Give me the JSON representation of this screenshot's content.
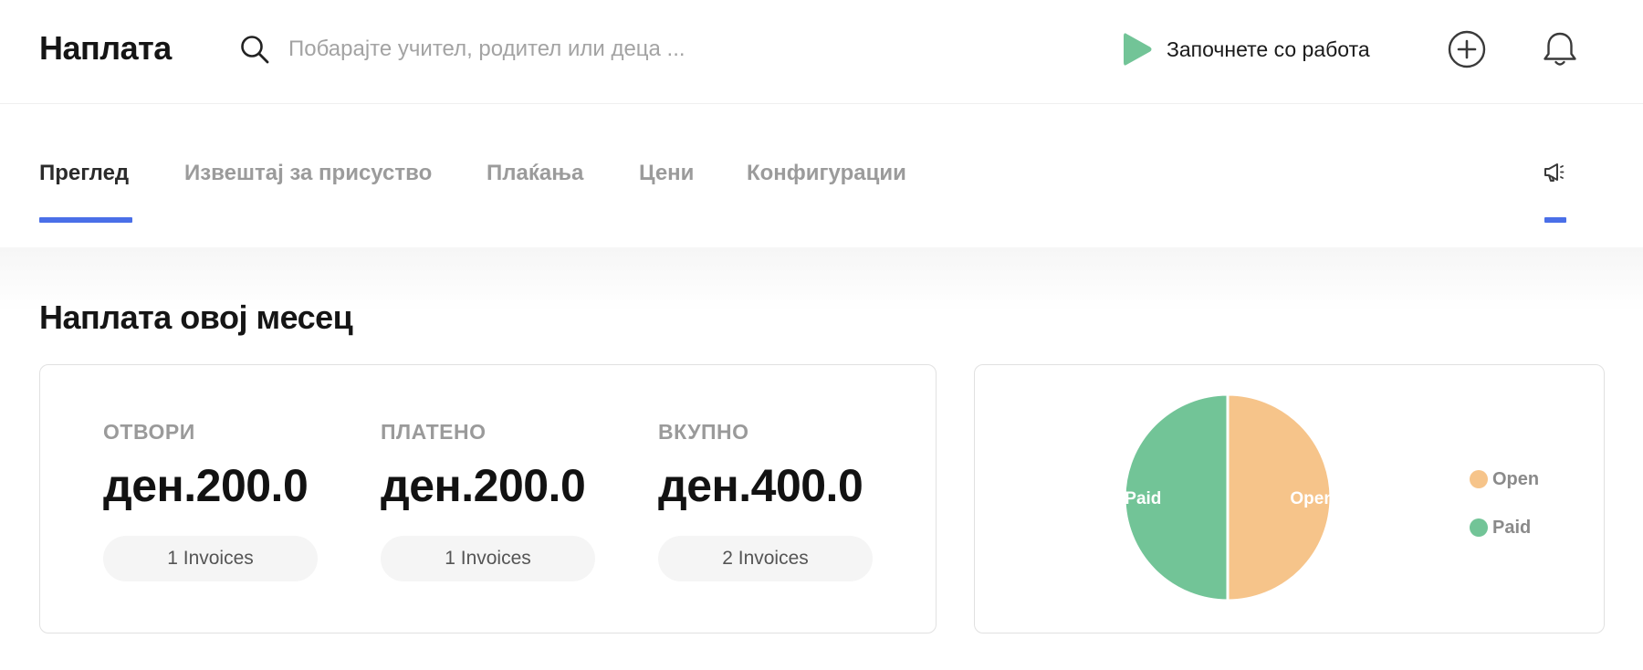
{
  "header": {
    "title": "Наплата",
    "search_placeholder": "Побарајте учител, родител или деца ...",
    "get_started_label": "Започнете со работа",
    "icons": {
      "search": "search-icon",
      "play": "play-icon",
      "add": "plus-circle-icon",
      "bell": "bell-icon"
    }
  },
  "tabs": {
    "items": [
      {
        "label": "Преглед",
        "active": true
      },
      {
        "label": "Извештај за присуство",
        "active": false
      },
      {
        "label": "Плаќања",
        "active": false
      },
      {
        "label": "Цени",
        "active": false
      },
      {
        "label": "Конфигурации",
        "active": false
      }
    ],
    "accent_color": "#4a6fe8",
    "announce_icon": "megaphone-icon"
  },
  "section": {
    "title": "Наплата овој месец"
  },
  "summary": {
    "stats": [
      {
        "label": "ОТВОРИ",
        "value": "ден.200.0",
        "badge": "1 Invoices"
      },
      {
        "label": "ПЛАТЕНО",
        "value": "ден.200.0",
        "badge": "1 Invoices"
      },
      {
        "label": "ВКУПНО",
        "value": "ден.400.0",
        "badge": "2 Invoices"
      }
    ]
  },
  "chart_data": {
    "type": "pie",
    "slices": [
      {
        "label": "Open",
        "value": 200,
        "color": "#f6c48a"
      },
      {
        "label": "Paid",
        "value": 200,
        "color": "#72c497"
      }
    ],
    "legend": [
      "Open",
      "Paid"
    ],
    "legend_position": "right"
  }
}
